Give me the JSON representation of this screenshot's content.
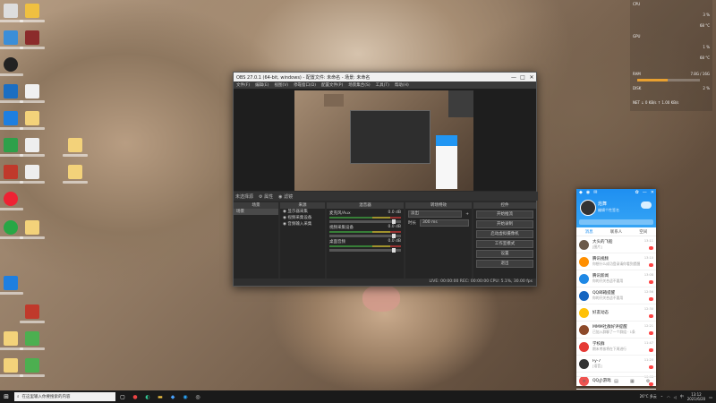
{
  "obs": {
    "title": "OBS 27.0.1 (64-bit, windows) - 配置文件: 未命名 - 场景: 未命名",
    "win_min": "—",
    "win_max": "□",
    "win_close": "✕",
    "menu": [
      "文件(F)",
      "编辑(E)",
      "视图(V)",
      "停靠窗口(D)",
      "配置文件(P)",
      "场景集合(S)",
      "工具(T)",
      "帮助(H)"
    ],
    "scene_bar": {
      "label": "未选择源",
      "props": "属性",
      "filters": "滤镜"
    },
    "docks": {
      "scenes": {
        "title": "场景",
        "items": [
          "场景"
        ]
      },
      "sources": {
        "title": "来源",
        "items": [
          "显示器采集",
          "视频采集设备",
          "音频输入采集"
        ]
      },
      "mixer": {
        "title": "混音器",
        "channels": [
          {
            "name": "麦克风/Aux",
            "db": "0.0 dB"
          },
          {
            "name": "视频采集设备",
            "db": "0.0 dB"
          },
          {
            "name": "桌面音频",
            "db": "0.0 dB"
          }
        ]
      },
      "transitions": {
        "title": "转场特效",
        "type": "淡出",
        "duration_label": "时长",
        "duration": "300 ms"
      },
      "controls": {
        "title": "控件",
        "buttons": [
          "开始推流",
          "开始录制",
          "启动虚拟摄像机",
          "工作室模式",
          "设置",
          "退出"
        ]
      }
    },
    "status": "LIVE: 00:00:00   REC: 00:00:00   CPU: 5.1%, 30.00 fps"
  },
  "qq": {
    "nickname": "焰舞",
    "signature": "编辑个性签名",
    "tabs": [
      "消息",
      "联系人",
      "空间"
    ],
    "items": [
      {
        "name": "大头的飞船",
        "msg": "[图片]",
        "time": "13:11",
        "color": "#6b5a4a"
      },
      {
        "name": "腾讯视频",
        "msg": "你想什么成功登录请你看到提醒",
        "time": "13:10",
        "color": "#ff8f00"
      },
      {
        "name": "腾讯新闻",
        "msg": "你的开关合适不要用",
        "time": "13:08",
        "color": "#1e88e5"
      },
      {
        "name": "QQ邮箱提醒",
        "msg": "你的开关合适不要用",
        "time": "12:56",
        "color": "#1565c0"
      },
      {
        "name": "好友动态",
        "msg": "",
        "time": "12:30",
        "color": "#ffc107"
      },
      {
        "name": "MMM社群好评提醒",
        "msg": "已加入群聊了一个群组 · 1条",
        "time": "12:21",
        "color": "#8d4a2a"
      },
      {
        "name": "学校群",
        "msg": "期末考核将在下周进行",
        "time": "11:47",
        "color": "#e53935"
      },
      {
        "name": "Fy-7",
        "msg": "[语音]",
        "time": "11:20",
        "color": "#333333"
      },
      {
        "name": "QQ小游戏",
        "msg": "",
        "time": "10:08",
        "color": "#ef5350"
      }
    ]
  },
  "monitor": {
    "cpu_label": "CPU",
    "cpu_temp": "68 °C",
    "cpu_val": "3 %",
    "gpu_label": "GPU",
    "gpu_temp": "68 °C",
    "gpu_val": "1 %",
    "ram_label": "RAM",
    "ram_val": "7.8G / 16G",
    "disk_label": "DISK",
    "disk_val": "2 %",
    "net_label": "NET",
    "net_down": "0 KB/s",
    "net_up": "1.00 KB/s"
  },
  "taskbar": {
    "search_placeholder": "在这里输入你要搜索的内容",
    "time": "13:12",
    "date": "2021/6/20",
    "weather": "26°C 多云"
  }
}
